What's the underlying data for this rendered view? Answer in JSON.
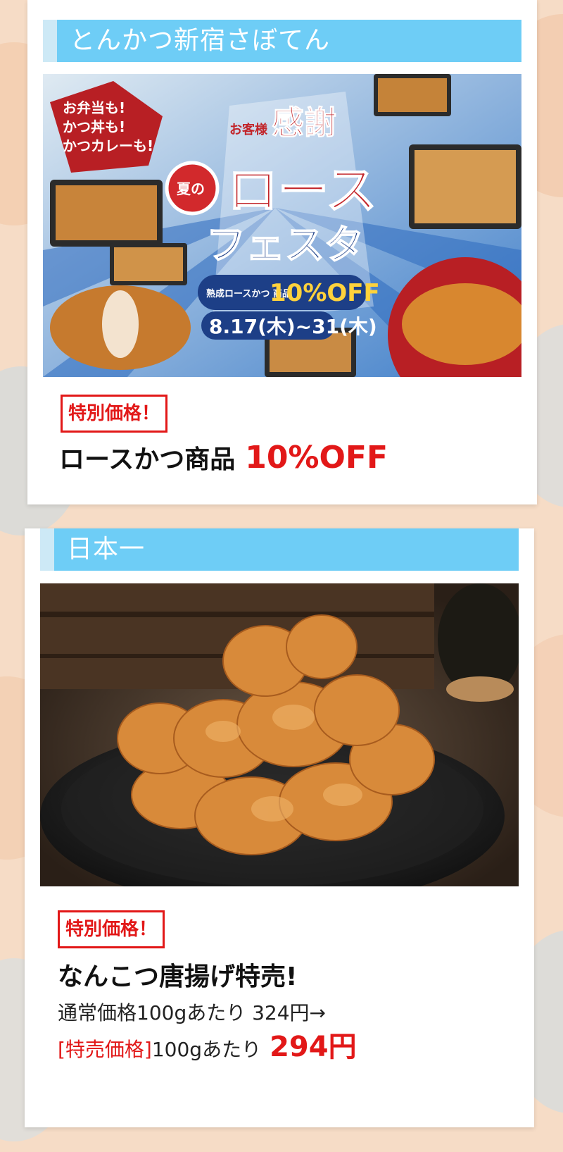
{
  "cards": [
    {
      "shop_name": "とんかつ新宿さぼてん",
      "photo_text": {
        "top_left": [
          "お弁当も!",
          "かつ丼も!",
          "かつカレーも!"
        ],
        "okyakusama": "お客様",
        "kansha": "感謝",
        "natsu_no": "夏の",
        "rosu": "ロース",
        "fesuta": "フェスタ",
        "promo_small": "熟成ロースかつ 商品",
        "promo_off": "10%OFF",
        "dates": "8.17(木)~31(木)"
      },
      "badge": "特別価格！",
      "product": "ロースかつ商品",
      "discount": "10%OFF"
    },
    {
      "shop_name": "日本一",
      "badge": "特別価格！",
      "product": "なんこつ唐揚げ特売!",
      "regular_price_line": "通常価格100gあたり 324円→",
      "sale_label": "[特売価格]",
      "sale_unit": "100gあたり",
      "sale_price": "294円"
    }
  ],
  "colors": {
    "header_blue": "#6ecdf6",
    "accent_red": "#e21818"
  }
}
